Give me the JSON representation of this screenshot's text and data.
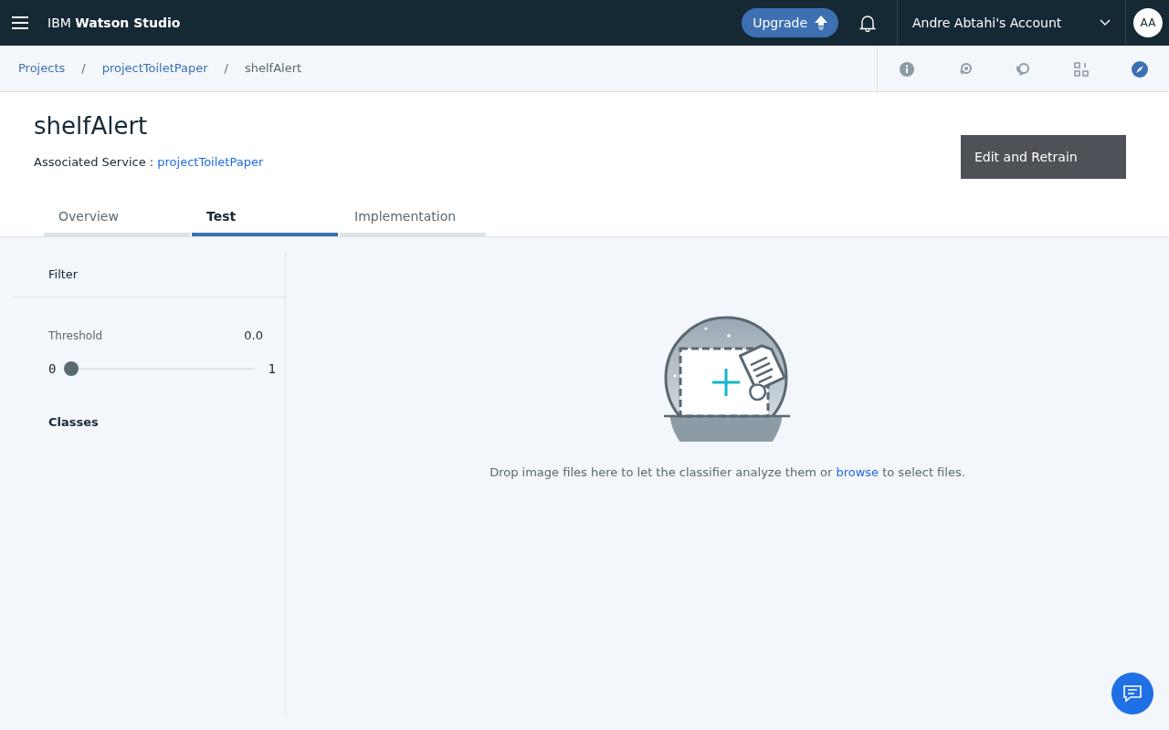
{
  "top_bar": {
    "brand_prefix": "IBM",
    "brand_name": "Watson Studio",
    "upgrade_button": "Upgrade",
    "account": "Andre Abtahi's Account",
    "avatar": "AA"
  },
  "breadcrumbs": [
    {
      "label": "Projects",
      "link": true
    },
    {
      "label": "projectToiletPaper",
      "link": true
    },
    {
      "label": "shelfAlert",
      "link": false
    }
  ],
  "separator": "/",
  "header": {
    "title": "shelfAlert",
    "service_label": "Associated Service :",
    "service_link": "projectToiletPaper",
    "action_button": "Edit and Retrain"
  },
  "tabs": [
    {
      "label": "Overview",
      "selected": false
    },
    {
      "label": "Test",
      "selected": true
    },
    {
      "label": "Implementation",
      "selected": false
    }
  ],
  "filter": {
    "title": "Filter",
    "threshold_label": "Threshold",
    "threshold_value": "0.0",
    "min": "0",
    "max": "1",
    "level": 0,
    "classes_title": "Classes"
  },
  "dropzone": {
    "text_before": "Drop image files here to let the classifier analyze them or",
    "link": "browse",
    "text_after": "to select files."
  }
}
